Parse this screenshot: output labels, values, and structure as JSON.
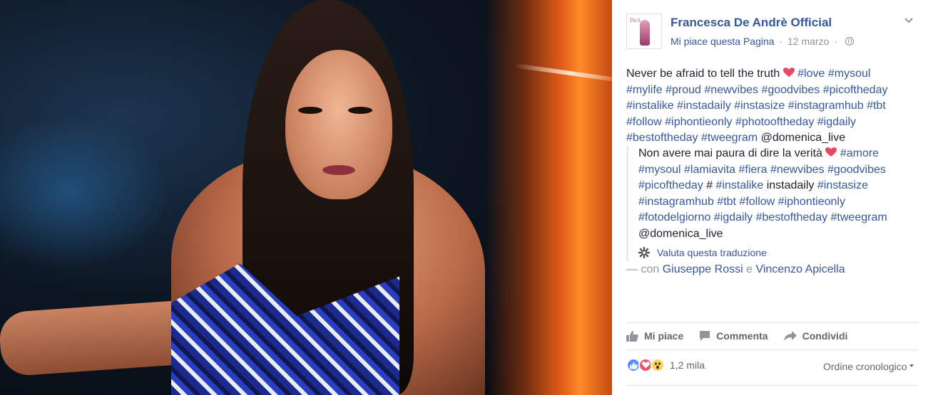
{
  "post": {
    "page_name": "Francesca De Andrè Official",
    "avatar_mark": "DeA",
    "liked_label": "Mi piace questa Pagina",
    "separator": "·",
    "date": "12 marzo",
    "privacy_icon": "globe-icon",
    "menu_icon": "chevron-down-icon",
    "text": {
      "lead": "Never be afraid to tell the truth",
      "hashtags_1": "#love #mysoul",
      "hashtags_2": "#mylife #proud #newvibes #goodvibes #picoftheday",
      "hashtags_3": "#instalike #instadaily #instasize #instagramhub #tbt",
      "hashtags_4": "#follow #iphontieonly #photooftheday #igdaily",
      "hashtags_5": "#bestoftheday #tweegram",
      "mention": "@domenica_live"
    },
    "translation": {
      "lead": "Non avere mai paura di dire la verità",
      "hashtags_1": "#amore",
      "hashtags_2": "#mysoul #lamiavita #fiera #newvibes #goodvibes",
      "hashtags_3a": "#picoftheday",
      "hash_symbol": "#",
      "hashtags_3b": "#instalike",
      "plain_3": "instadaily",
      "hashtags_3c": "#instasize",
      "hashtags_4": "#instagramhub #tbt #follow #iphontieonly",
      "hashtags_5": "#fotodelgiorno #igdaily #bestoftheday #tweegram",
      "mention": "@domenica_live",
      "rate_label": "Valuta questa traduzione"
    },
    "with": {
      "prefix": "— con",
      "person_1": "Giuseppe Rossi",
      "conj": "e",
      "person_2": "Vincenzo Apicella"
    },
    "actions": {
      "like": "Mi piace",
      "comment": "Commenta",
      "share": "Condividi"
    },
    "reactions": {
      "types": [
        "like",
        "love",
        "wow"
      ],
      "count": "1,2 mila"
    },
    "order_label": "Ordine cronologico"
  },
  "colors": {
    "link": "#365899",
    "muted": "#90949c",
    "text": "#1d2129",
    "like": "#5890ff",
    "love": "#f25268",
    "wow": "#fcd35c"
  }
}
